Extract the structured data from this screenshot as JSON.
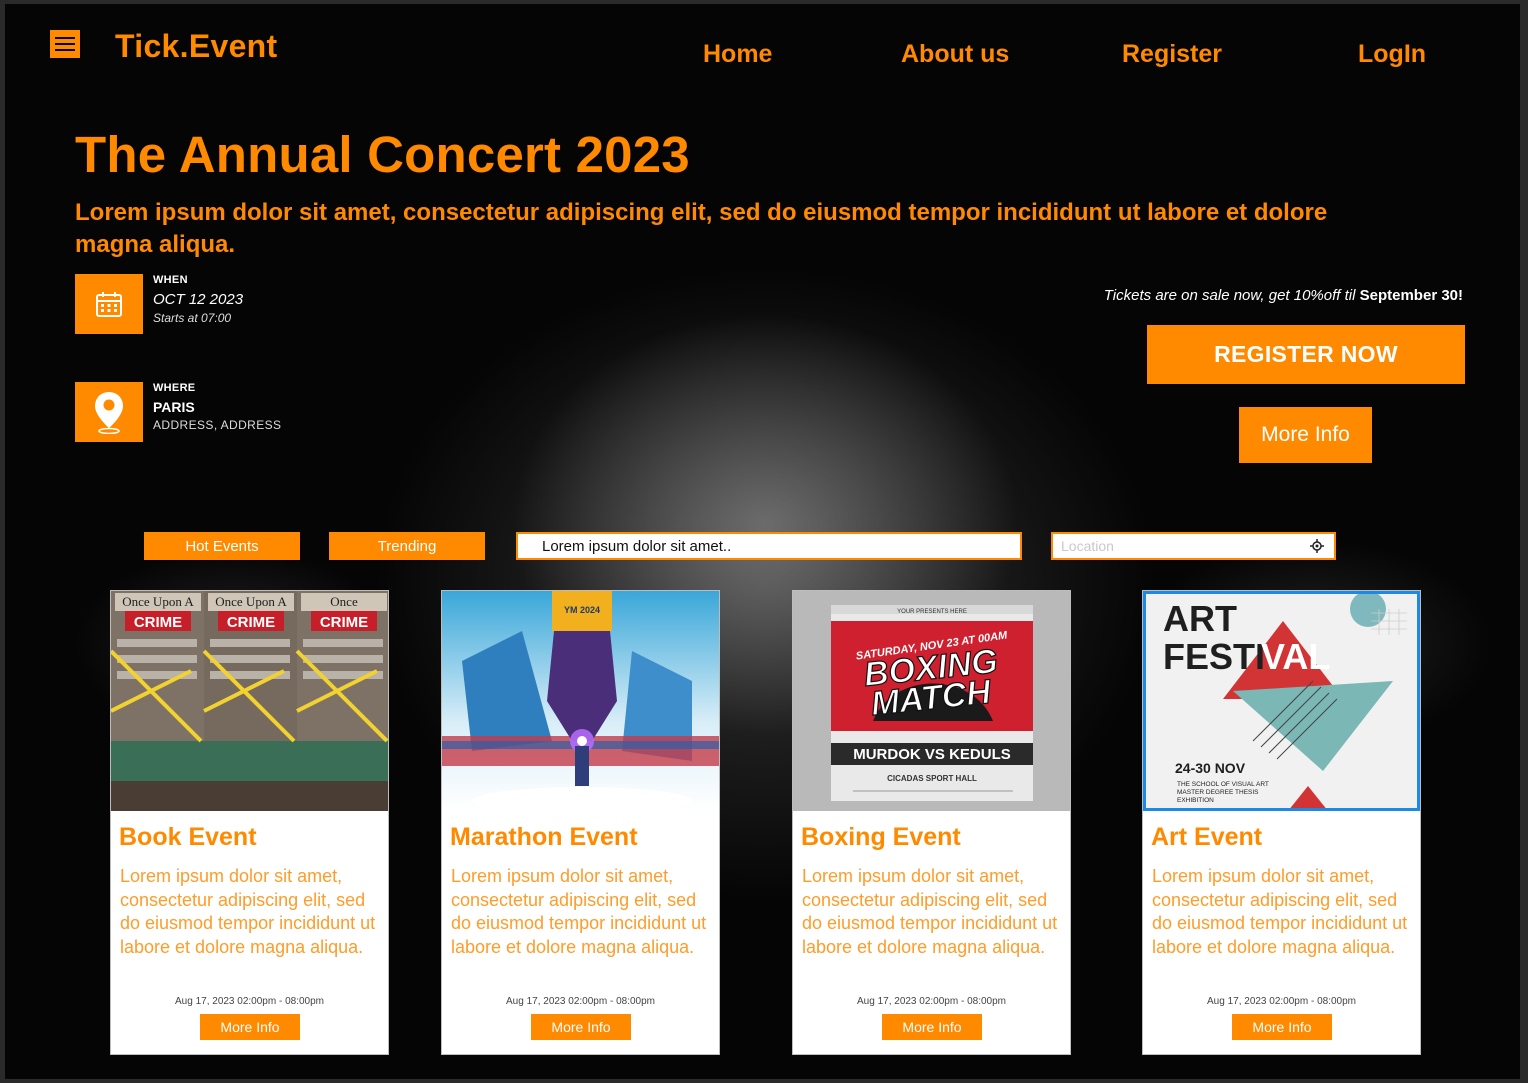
{
  "header": {
    "logo": "Tick.Event",
    "nav": {
      "home": "Home",
      "about": "About us",
      "register": "Register",
      "login": "LogIn"
    }
  },
  "hero": {
    "title": "The Annual Concert 2023",
    "subtitle": "Lorem ipsum dolor sit amet, consectetur adipiscing elit, sed do eiusmod tempor incididunt ut labore et dolore magna aliqua.",
    "when": {
      "label": "WHEN",
      "date": "OCT 12 2023",
      "time": "Starts at 07:00"
    },
    "where": {
      "label": "WHERE",
      "city": "PARIS",
      "address": "ADDRESS, ADDRESS"
    },
    "promo_text": "Tickets are on sale now, get 10%off til",
    "promo_date": "September 30!",
    "register_button": "REGISTER NOW",
    "more_info_button": "More Info"
  },
  "filters": {
    "hot_events": "Hot Events",
    "trending": "Trending",
    "search_value": "Lorem ipsum dolor sit amet..",
    "location_placeholder": "Location"
  },
  "cards": [
    {
      "title": "Book Event",
      "description": "Lorem ipsum dolor sit amet, consectetur adipiscing elit, sed do eiusmod tempor incididunt ut labore et dolore magna aliqua.",
      "date": "Aug 17, 2023 02:00pm - 08:00pm",
      "button": "More Info",
      "image_text": "Once Upon A CRIME"
    },
    {
      "title": "Marathon Event",
      "description": "Lorem ipsum dolor sit amet, consectetur adipiscing elit, sed do eiusmod tempor incididunt ut labore et dolore magna aliqua.",
      "date": "Aug 17, 2023 02:00pm - 08:00pm",
      "button": "More Info",
      "image_text": "YM 2024"
    },
    {
      "title": "Boxing Event",
      "description": "Lorem ipsum dolor sit amet, consectetur adipiscing elit, sed do eiusmod tempor incididunt ut labore et dolore magna aliqua.",
      "date": "Aug 17, 2023 02:00pm - 08:00pm",
      "button": "More Info",
      "image_text": "SATURDAY, NOV 23 AT 00AM BOXING MATCH MURDOK VS KEDULS"
    },
    {
      "title": "Art Event",
      "description": "Lorem ipsum dolor sit amet, consectetur adipiscing elit, sed do eiusmod tempor incididunt ut labore et dolore magna aliqua.",
      "date": "Aug 17, 2023 02:00pm - 08:00pm",
      "button": "More Info",
      "image_text": "ART FESTIVAL 24-30 NOV THE SCHOOL OF VISUAL ART MASTER DEGREE THESIS EXHIBITION"
    }
  ],
  "colors": {
    "accent": "#ff8a00",
    "background": "#050505",
    "selection": "#1e88e5"
  }
}
